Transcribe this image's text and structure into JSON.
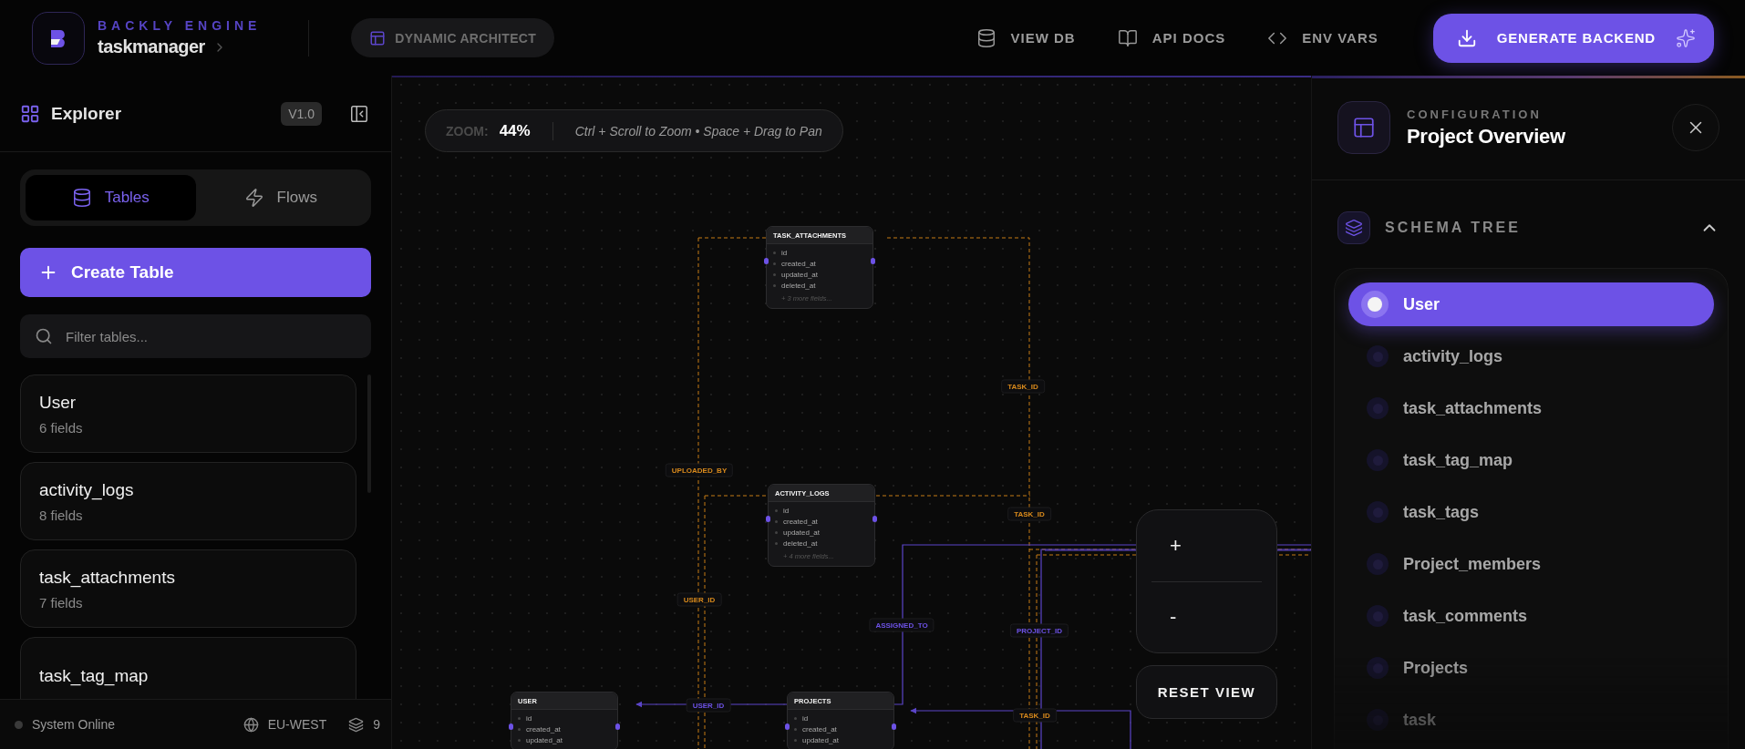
{
  "topbar": {
    "brand": "BACKLY ENGINE",
    "project": "taskmanager",
    "mode": "DYNAMIC ARCHITECT",
    "nav": [
      {
        "label": "VIEW DB",
        "kind": "database"
      },
      {
        "label": "API DOCS",
        "kind": "docs"
      },
      {
        "label": "ENV VARS",
        "kind": "code"
      }
    ],
    "generate_button": "GENERATE BACKEND"
  },
  "sidebar": {
    "title": "Explorer",
    "version": "V1.0",
    "tabs": [
      {
        "label": "Tables",
        "kind": "tables",
        "selected": true
      },
      {
        "label": "Flows",
        "kind": "flows",
        "selected": false
      }
    ],
    "create_button": "Create Table",
    "filter": {
      "placeholder": "Filter tables..."
    },
    "tables": [
      {
        "name": "User",
        "fields": "6 fields"
      },
      {
        "name": "activity_logs",
        "fields": "8 fields"
      },
      {
        "name": "task_attachments",
        "fields": "7 fields"
      },
      {
        "name": "task_tag_map"
      }
    ],
    "status": {
      "label": "System Online",
      "region": "EU-WEST",
      "count": "9"
    }
  },
  "canvas": {
    "zoom_label": "ZOOM:",
    "zoom_value": "44%",
    "hint": "Ctrl + Scroll to Zoom • Space + Drag to Pan",
    "nodes": [
      {
        "title": "TASK_ATTACHMENTS",
        "fields": [
          "id",
          "created_at",
          "updated_at",
          "deleted_at"
        ],
        "more": "+ 3 more fields..."
      },
      {
        "title": "ACTIVITY_LOGS",
        "fields": [
          "id",
          "created_at",
          "updated_at",
          "deleted_at"
        ],
        "more": "+ 4 more fields..."
      },
      {
        "title": "USER",
        "fields": [
          "id",
          "created_at",
          "updated_at"
        ]
      },
      {
        "title": "PROJECTS",
        "fields": [
          "id",
          "created_at",
          "updated_at"
        ]
      }
    ],
    "edge_labels": [
      {
        "label": "TASK_ID",
        "color": "#d98a1c"
      },
      {
        "label": "UPLOADED_BY",
        "color": "#d98a1c"
      },
      {
        "label": "TASK_ID",
        "color": "#d98a1c"
      },
      {
        "label": "USER_ID",
        "color": "#d98a1c"
      },
      {
        "label": "ASSIGNED_TO",
        "color": "#6d52e6"
      },
      {
        "label": "PROJECT_ID",
        "color": "#6d52e6"
      },
      {
        "label": "USER_ID",
        "color": "#6d52e6"
      },
      {
        "label": "TASK_ID",
        "color": "#d98a1c"
      }
    ],
    "zoom_in": "+",
    "zoom_out": "-",
    "reset_button": "RESET VIEW"
  },
  "panel": {
    "eyebrow": "CONFIGURATION",
    "title": "Project Overview",
    "section": {
      "title": "SCHEMA TREE",
      "expanded": true
    },
    "items": [
      {
        "label": "User",
        "selected": true
      },
      {
        "label": "activity_logs",
        "selected": false
      },
      {
        "label": "task_attachments",
        "selected": false
      },
      {
        "label": "task_tag_map",
        "selected": false
      },
      {
        "label": "task_tags",
        "selected": false
      },
      {
        "label": "Project_members",
        "selected": false
      },
      {
        "label": "task_comments",
        "selected": false
      },
      {
        "label": "Projects",
        "selected": false
      },
      {
        "label": "task",
        "selected": false
      }
    ]
  }
}
